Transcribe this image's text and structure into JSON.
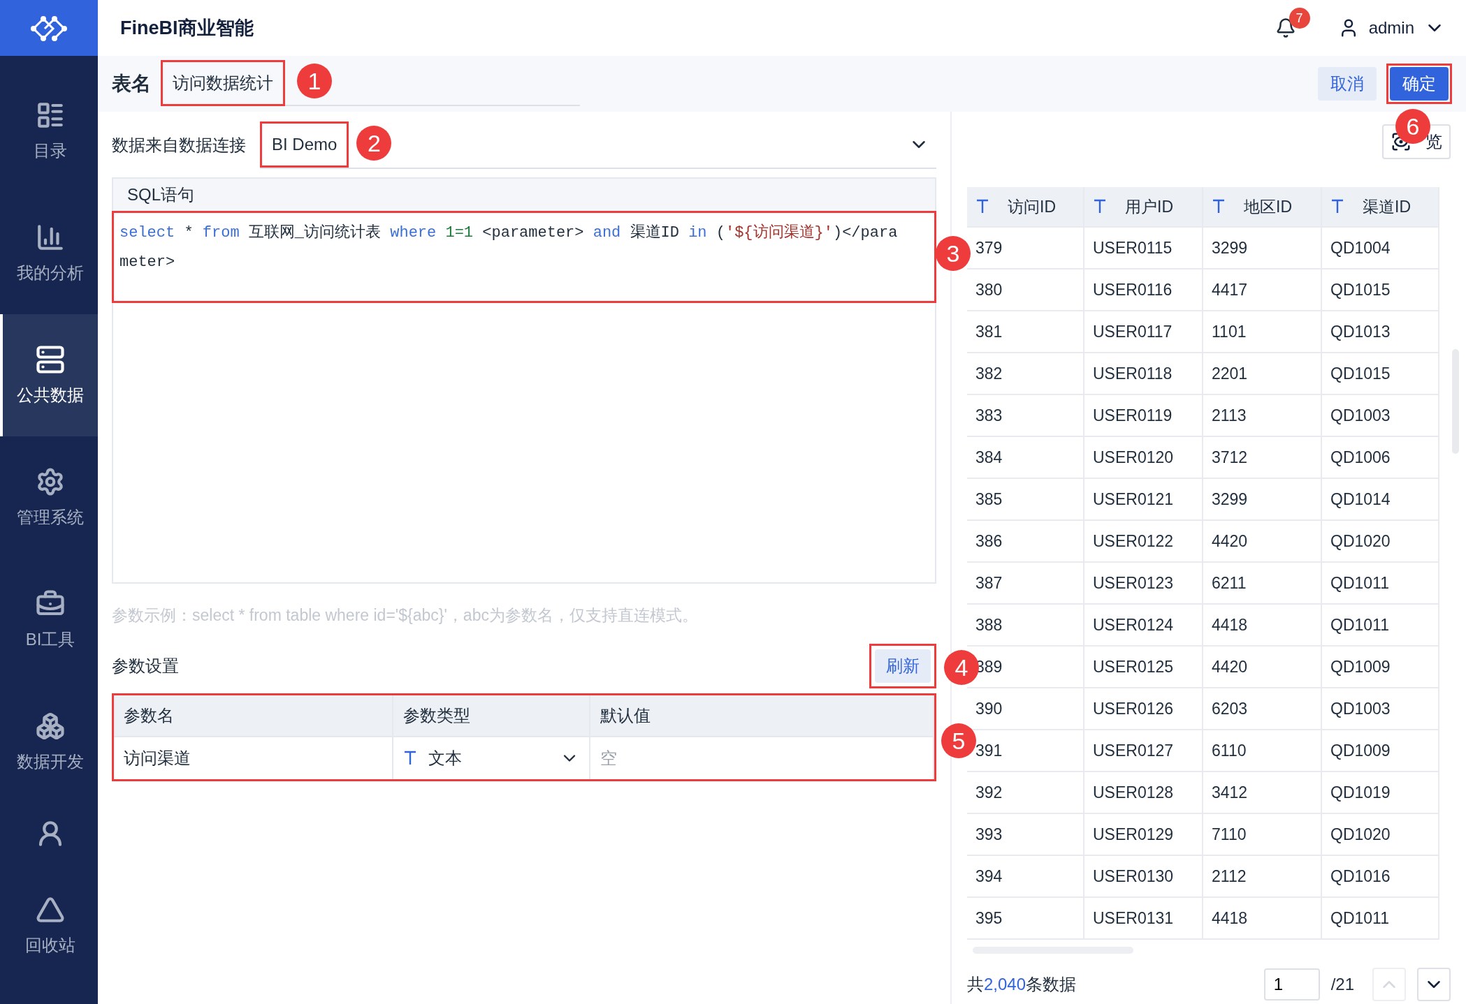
{
  "app": {
    "title": "FineBI商业智能"
  },
  "header": {
    "notifications": "7",
    "user": "admin"
  },
  "sidebar": {
    "items": [
      {
        "label": "目录",
        "selected": false
      },
      {
        "label": "我的分析",
        "selected": false
      },
      {
        "label": "公共数据",
        "selected": true
      },
      {
        "label": "管理系统",
        "selected": false
      },
      {
        "label": "BI工具",
        "selected": false
      },
      {
        "label": "数据开发",
        "selected": false
      },
      {
        "selected": false
      },
      {
        "label": "回收站",
        "selected": false
      }
    ]
  },
  "toolbar": {
    "label": "表名",
    "table_name": "访问数据统计",
    "callout": "1",
    "buttons": [
      {
        "label": "取消",
        "kind": "secondary"
      },
      {
        "label": "确定",
        "kind": "primary",
        "callout": "6"
      }
    ]
  },
  "connection": {
    "label": "数据来自数据连接",
    "value": "BI Demo",
    "callout": "2"
  },
  "sql": {
    "title": "SQL语句",
    "callout": "3",
    "tokens": [
      {
        "text": "select",
        "kind": "keyword"
      },
      {
        "text": " * ",
        "kind": "plain"
      },
      {
        "text": "from",
        "kind": "keyword"
      },
      {
        "text": " 互联网_访问统计表 ",
        "kind": "plain"
      },
      {
        "text": "where",
        "kind": "keyword"
      },
      {
        "text": " 1=1",
        "kind": "number"
      },
      {
        "text": " <parameter> ",
        "kind": "plain"
      },
      {
        "text": "and",
        "kind": "keyword"
      },
      {
        "text": " 渠道ID ",
        "kind": "plain"
      },
      {
        "text": "in",
        "kind": "keyword"
      },
      {
        "text": " (",
        "kind": "plain"
      },
      {
        "text": "'${访问渠道}'",
        "kind": "string"
      },
      {
        "text": ")</parameter>",
        "kind": "plain"
      }
    ]
  },
  "hint": "参数示例：select * from table where id='${abc}'，abc为参数名，仅支持直连模式。",
  "params": {
    "title": "参数设置",
    "refresh": "刷新",
    "refresh_callout": "4",
    "table_callout": "5",
    "columns": [
      "参数名",
      "参数类型",
      "默认值"
    ],
    "rows": [
      {
        "name": "访问渠道",
        "type": "文本",
        "default_placeholder": "空"
      }
    ]
  },
  "preview": {
    "button": "览",
    "columns": [
      "访问ID",
      "用户ID",
      "地区ID",
      "渠道ID"
    ],
    "rows": [
      [
        "379",
        "USER0115",
        "3299",
        "QD1004"
      ],
      [
        "380",
        "USER0116",
        "4417",
        "QD1015"
      ],
      [
        "381",
        "USER0117",
        "1101",
        "QD1013"
      ],
      [
        "382",
        "USER0118",
        "2201",
        "QD1015"
      ],
      [
        "383",
        "USER0119",
        "2113",
        "QD1003"
      ],
      [
        "384",
        "USER0120",
        "3712",
        "QD1006"
      ],
      [
        "385",
        "USER0121",
        "3299",
        "QD1014"
      ],
      [
        "386",
        "USER0122",
        "4420",
        "QD1020"
      ],
      [
        "387",
        "USER0123",
        "6211",
        "QD1011"
      ],
      [
        "388",
        "USER0124",
        "4418",
        "QD1011"
      ],
      [
        "389",
        "USER0125",
        "4420",
        "QD1009"
      ],
      [
        "390",
        "USER0126",
        "6203",
        "QD1003"
      ],
      [
        "391",
        "USER0127",
        "6110",
        "QD1009"
      ],
      [
        "392",
        "USER0128",
        "3412",
        "QD1019"
      ],
      [
        "393",
        "USER0129",
        "7110",
        "QD1020"
      ],
      [
        "394",
        "USER0130",
        "2112",
        "QD1016"
      ],
      [
        "395",
        "USER0131",
        "4418",
        "QD1011"
      ]
    ],
    "footer": {
      "prefix": "共",
      "count": "2,040",
      "suffix": "条数据",
      "page": "1",
      "total": "/21",
      "prev_disabled": true,
      "next_disabled": false
    }
  }
}
